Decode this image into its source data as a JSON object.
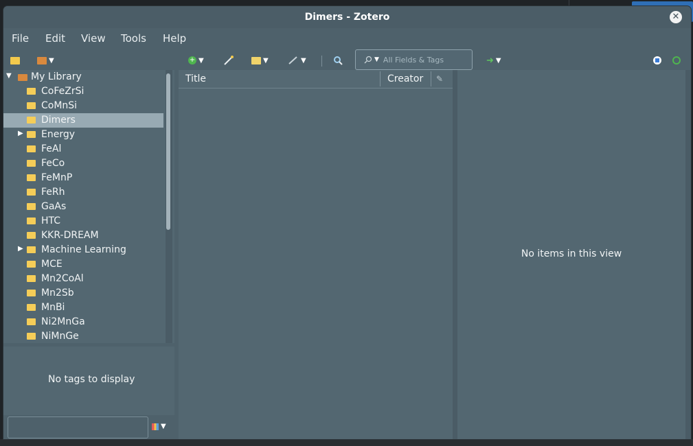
{
  "window": {
    "title": "Dimers - Zotero",
    "close_glyph": "✕"
  },
  "menu": [
    {
      "label": "File"
    },
    {
      "label": "Edit"
    },
    {
      "label": "View"
    },
    {
      "label": "Tools"
    },
    {
      "label": "Help"
    }
  ],
  "toolbar": {
    "icons": [
      "new-collection-icon",
      "new-library-icon",
      "new-item-icon",
      "add-by-identifier-icon",
      "new-note-icon",
      "attachment-icon",
      "advanced-search-icon",
      "locate-icon",
      "sync-status-icon",
      "sync-icon"
    ],
    "search_placeholder": "All Fields & Tags"
  },
  "collections": {
    "library_label": "My Library",
    "items": [
      {
        "label": "CoFeZrSi",
        "expandable": false,
        "selected": false
      },
      {
        "label": "CoMnSi",
        "expandable": false,
        "selected": false
      },
      {
        "label": "Dimers",
        "expandable": false,
        "selected": true
      },
      {
        "label": "Energy",
        "expandable": true,
        "selected": false
      },
      {
        "label": "FeAl",
        "expandable": false,
        "selected": false
      },
      {
        "label": "FeCo",
        "expandable": false,
        "selected": false
      },
      {
        "label": "FeMnP",
        "expandable": false,
        "selected": false
      },
      {
        "label": "FeRh",
        "expandable": false,
        "selected": false
      },
      {
        "label": "GaAs",
        "expandable": false,
        "selected": false
      },
      {
        "label": "HTC",
        "expandable": false,
        "selected": false
      },
      {
        "label": "KKR-DREAM",
        "expandable": false,
        "selected": false
      },
      {
        "label": "Machine Learning",
        "expandable": true,
        "selected": false
      },
      {
        "label": "MCE",
        "expandable": false,
        "selected": false
      },
      {
        "label": "Mn2CoAl",
        "expandable": false,
        "selected": false
      },
      {
        "label": "Mn2Sb",
        "expandable": false,
        "selected": false
      },
      {
        "label": "MnBi",
        "expandable": false,
        "selected": false
      },
      {
        "label": "Ni2MnGa",
        "expandable": false,
        "selected": false
      },
      {
        "label": "NiMnGe",
        "expandable": false,
        "selected": false
      }
    ]
  },
  "tags": {
    "empty_text": "No tags to display"
  },
  "items_table": {
    "columns": [
      "Title",
      "Creator"
    ]
  },
  "item_pane": {
    "empty_text": "No items in this view"
  },
  "colors": {
    "window_bg": "#4e616b",
    "pane_bg": "#536771",
    "selection": "#98aab3",
    "folder": "#f5cd58"
  }
}
